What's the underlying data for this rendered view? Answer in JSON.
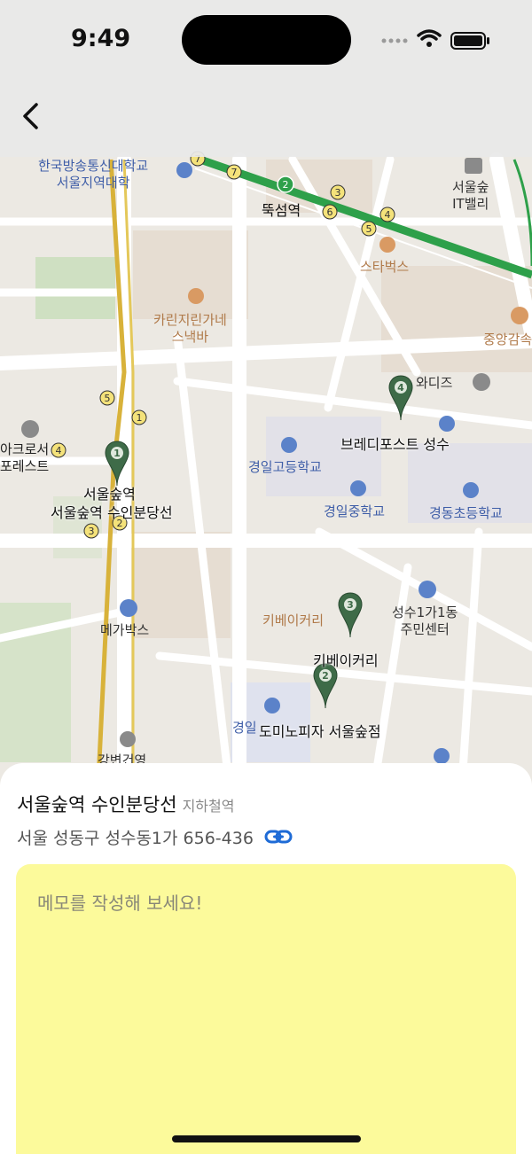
{
  "status_bar": {
    "time": "9:49"
  },
  "map": {
    "labels": [
      {
        "key": "kbs_univ",
        "text": "한국방송통신대학교\n서울지역대학",
        "color": "blue"
      },
      {
        "key": "ttukseom",
        "text": "뚝섬역",
        "color": "dark"
      },
      {
        "key": "seoulsup_it",
        "text": "서울숲\nIT밸리",
        "color": "normal"
      },
      {
        "key": "starbucks",
        "text": "스타벅스",
        "color": "orange"
      },
      {
        "key": "karin",
        "text": "카린지린가네\n스낵바",
        "color": "orange"
      },
      {
        "key": "junganggam",
        "text": "중앙감속",
        "color": "orange"
      },
      {
        "key": "acro",
        "text": "아크로서\n포레스트",
        "color": "dark"
      },
      {
        "key": "awadiz",
        "text": "와디즈",
        "color": "normal"
      },
      {
        "key": "kyungil_high",
        "text": "경일고등학교",
        "color": "blue"
      },
      {
        "key": "kyungil_mid",
        "text": "경일중학교",
        "color": "blue"
      },
      {
        "key": "kyungdong_elem",
        "text": "경동초등학교",
        "color": "blue"
      },
      {
        "key": "megabox",
        "text": "메가박스",
        "color": "normal"
      },
      {
        "key": "seongsu_center",
        "text": "성수1가1동\n주민센터",
        "color": "normal"
      },
      {
        "key": "kibe_map",
        "text": "키베이커리",
        "color": "orange"
      },
      {
        "key": "gyeongil_bottom",
        "text": "경일",
        "color": "blue"
      },
      {
        "key": "gangbyeon",
        "text": "강변건영",
        "color": "normal"
      }
    ],
    "pins": [
      {
        "number": "1",
        "label": "서울숲역\n서울숲역 수인분당선"
      },
      {
        "number": "2",
        "label": "도미노피자 서울숲점"
      },
      {
        "number": "3",
        "label": "키베이커리"
      },
      {
        "number": "4",
        "label": "브레디포스트 성수"
      }
    ],
    "subway_badges": [
      "7",
      "7",
      "2",
      "3",
      "6",
      "4",
      "5",
      "5",
      "1",
      "4",
      "3",
      "2"
    ]
  },
  "place": {
    "name": "서울숲역 수인분당선",
    "category": "지하철역",
    "address": "서울 성동구 성수동1가 656-436"
  },
  "memo": {
    "placeholder": "메모를 작성해 보세요!"
  },
  "colors": {
    "pin": "#3e6b48",
    "memo_bg": "#fcfa9b",
    "link": "#1e6bd6",
    "subway_line2": "#2ea04a"
  }
}
